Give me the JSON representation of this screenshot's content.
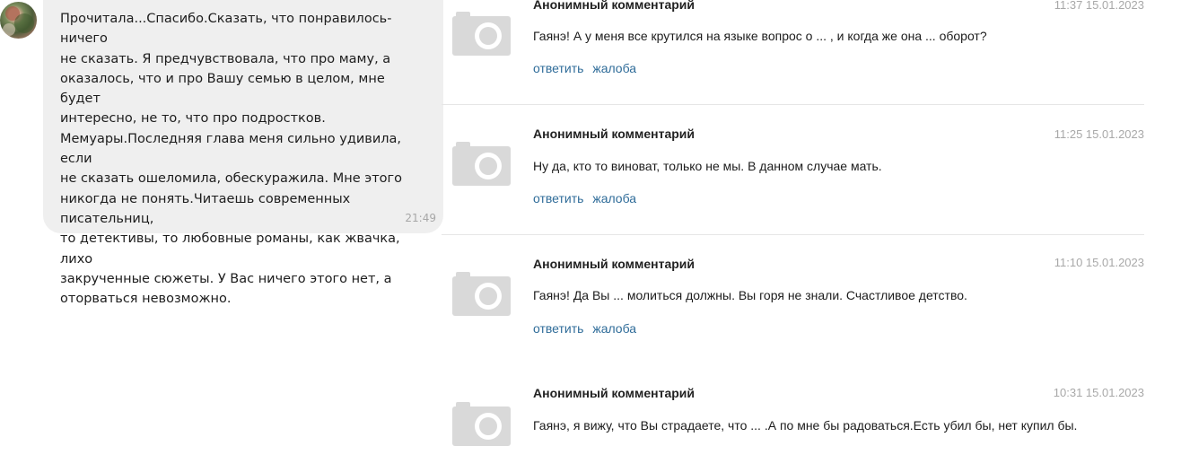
{
  "chat": {
    "message": "Прочитала...Спасибо.Сказать, что понравилось-ничего\nне сказать. Я предчувствовала, что про маму, а\nоказалось, что и про Вашу семью в целом, мне будет\nинтересно, не то, что про подростков.\nМемуары.Последняя глава меня сильно удивила, если\nне сказать ошеломила, обескуражила. Мне этого\nникогда не понять.Читаешь современных писательниц,\nто детективы, то любовные романы, как жвачка,  лихо\nзакрученные сюжеты. У Вас ничего этого нет, а\nоторваться невозможно.",
    "time": "21:49"
  },
  "comments": [
    {
      "author": "Анонимный комментарий",
      "date": "11:37 15.01.2023",
      "text": "Гаянэ! А у меня все крутился на языке вопрос о ... , и когда же она ... оборот?",
      "reply": "ответить",
      "report": "жалоба"
    },
    {
      "author": "Анонимный комментарий",
      "date": "11:25 15.01.2023",
      "text": "Ну да, кто то виноват, только не мы. В данном случае мать.",
      "reply": "ответить",
      "report": "жалоба"
    },
    {
      "author": "Анонимный комментарий",
      "date": "11:10 15.01.2023",
      "text": "Гаянэ! Да Вы ... молиться должны. Вы горя не знали. Счастливое детство.",
      "reply": "ответить",
      "report": "жалоба"
    },
    {
      "author": "Анонимный комментарий",
      "date": "10:31 15.01.2023",
      "text": "Гаянэ, я вижу, что Вы страдаете, что ... .А по мне бы радоваться.Есть убил бы, нет купил бы.",
      "reply": "ответить",
      "report": "жалоба"
    }
  ],
  "icons": {
    "photo_placeholder": "camera-placeholder-icon",
    "avatar": "user-avatar"
  },
  "colors": {
    "bubble_bg": "#efefef",
    "link": "#2f6c99",
    "date": "#a8a8a8",
    "placeholder": "#d9d9d9"
  }
}
